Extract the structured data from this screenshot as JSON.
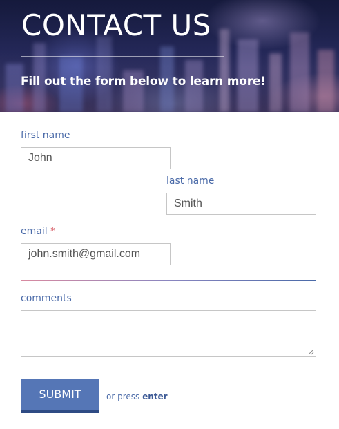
{
  "header": {
    "title": "CONTACT US",
    "subtitle": "Fill out the form below to learn more!"
  },
  "form": {
    "first_name": {
      "label": "first name",
      "value": "John"
    },
    "last_name": {
      "label": "last name",
      "value": "Smith"
    },
    "email": {
      "label": "email",
      "required_marker": "*",
      "value": "john.smith@gmail.com"
    },
    "comments": {
      "label": "comments",
      "value": ""
    },
    "submit_label": "SUBMIT",
    "hint_prefix": "or press",
    "hint_key": "enter"
  },
  "colors": {
    "label": "#4a6aa8",
    "required": "#d9666f",
    "button": "#5576b6",
    "button_border": "#2e4b84"
  }
}
